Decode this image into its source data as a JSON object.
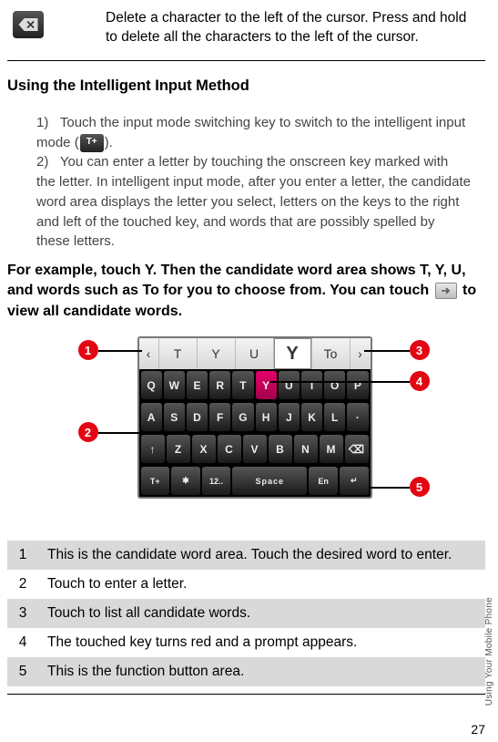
{
  "delete_key": {
    "description": "Delete a character to the left of the cursor. Press and hold to delete all the characters to the left of the cursor."
  },
  "section_title": "Using the Intelligent Input Method",
  "steps": {
    "s1_num": "1)",
    "s1_a": "Touch the input mode switching key to switch to the intelligent input mode (",
    "mode_label": "T+",
    "s1_b": ").",
    "s2_num": "2)",
    "s2": "You can enter a letter by touching the onscreen key marked with the letter. In intelligent input mode, after you enter a letter, the candidate word area displays the letter you select, letters on the keys to the right and left of the touched key, and words that are possibly spelled by these letters."
  },
  "example": {
    "a": "For example, touch Y. Then the candidate word area shows T, Y, U, and words such as To for you to choose from. You can touch ",
    "b": " to view all candidate words."
  },
  "keyboard": {
    "candidates": [
      "T",
      "Y",
      "U",
      "Y",
      "To"
    ],
    "row1": [
      "Q",
      "W",
      "E",
      "R",
      "T",
      "Y",
      "U",
      "I",
      "O",
      "P"
    ],
    "row2": [
      "A",
      "S",
      "D",
      "F",
      "G",
      "H",
      "J",
      "K",
      "L",
      "·"
    ],
    "row3": [
      "↑",
      "Z",
      "X",
      "C",
      "V",
      "B",
      "N",
      "M",
      "⌫"
    ],
    "row4_mode": "T+",
    "row4_sym": "✱",
    "row4_num": "12..",
    "row4_space": "Space",
    "row4_lang": "En",
    "row4_enter": "↵"
  },
  "callouts": {
    "c1": "1",
    "c2": "2",
    "c3": "3",
    "c4": "4",
    "c5": "5"
  },
  "table": {
    "r1n": "1",
    "r1": "This is the candidate word area. Touch the desired word to enter.",
    "r2n": "2",
    "r2": "Touch to enter a letter.",
    "r3n": "3",
    "r3": "Touch to list all candidate words.",
    "r4n": "4",
    "r4": "The touched key turns red and a prompt appears.",
    "r5n": "5",
    "r5": "This is the function button area."
  },
  "page_number": "27",
  "side_label": "Using Your Mobile Phone"
}
